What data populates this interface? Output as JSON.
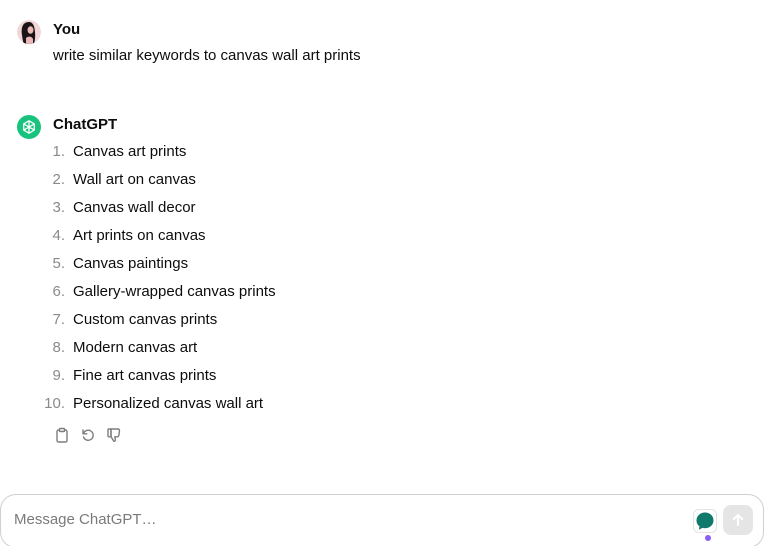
{
  "user_message": {
    "author": "You",
    "text": "write similar keywords to canvas wall art prints"
  },
  "assistant_message": {
    "author": "ChatGPT",
    "items": [
      {
        "num": "1.",
        "text": "Canvas art prints"
      },
      {
        "num": "2.",
        "text": "Wall art on canvas"
      },
      {
        "num": "3.",
        "text": "Canvas wall decor"
      },
      {
        "num": "4.",
        "text": "Art prints on canvas"
      },
      {
        "num": "5.",
        "text": "Canvas paintings"
      },
      {
        "num": "6.",
        "text": "Gallery-wrapped canvas prints"
      },
      {
        "num": "7.",
        "text": "Custom canvas prints"
      },
      {
        "num": "8.",
        "text": "Modern canvas art"
      },
      {
        "num": "9.",
        "text": "Fine art canvas prints"
      },
      {
        "num": "10.",
        "text": "Personalized canvas wall art"
      }
    ]
  },
  "actions": {
    "icons": [
      "clipboard-icon",
      "regenerate-icon",
      "thumbs-down-icon"
    ]
  },
  "composer": {
    "placeholder": "Message ChatGPT…",
    "extension_icon": "chat-bubble-icon",
    "send_icon": "arrow-up-icon"
  },
  "colors": {
    "brand_green": "#19c37d",
    "extension_teal": "#0f7a6c",
    "indicator_purple": "#8b5cf6",
    "send_disabled": "#e5e5e5"
  }
}
